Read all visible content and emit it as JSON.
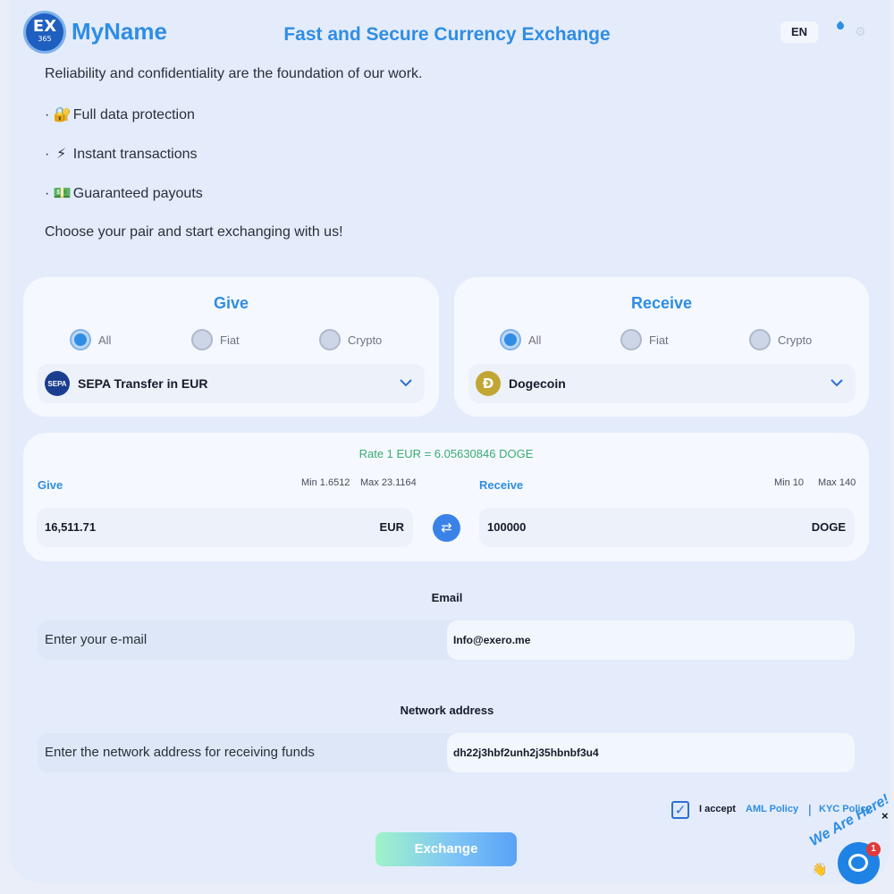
{
  "header": {
    "logo_text": "EX",
    "logo_sub": "365",
    "brand": "MyName",
    "headline": "Fast and Secure Currency Exchange",
    "lang": "EN"
  },
  "intro": {
    "line1": "Reliability and confidentiality are the foundation of our work.",
    "bullet1": "Full data protection",
    "bullet2": "Instant transactions",
    "bullet3": "Guaranteed payouts",
    "cta": "Choose your pair and start exchanging with us!",
    "bullet_prefix": "·",
    "emoji1": "🔐",
    "emoji2": "⚡",
    "emoji3": "💵"
  },
  "give": {
    "title": "Give",
    "filters": [
      "All",
      "Fiat",
      "Crypto"
    ],
    "selected_filter": "All",
    "currency": "SEPA Transfer in EUR",
    "currency_icon": "SEPA"
  },
  "receive": {
    "title": "Receive",
    "filters": [
      "All",
      "Fiat",
      "Crypto"
    ],
    "selected_filter": "All",
    "currency": "Dogecoin",
    "currency_icon": "Ð"
  },
  "calc": {
    "rate": "Rate 1 EUR = 6.05630846 DOGE",
    "give_label": "Give",
    "give_min": "Min 1.6512",
    "give_max": "Max 23.1164",
    "give_amount": "16,511.71",
    "give_currency": "EUR",
    "receive_label": "Receive",
    "receive_min": "Min 10",
    "receive_max": "Max 140",
    "receive_amount": "100000",
    "receive_currency": "DOGE",
    "swap_icon": "⇄"
  },
  "email": {
    "title": "Email",
    "placeholder": "Enter your e-mail",
    "value": "Info@exero.me"
  },
  "network": {
    "title": "Network address",
    "placeholder": "Enter the network address for receiving funds",
    "value": "dh22j3hbf2unh2j35hbnbf3u4"
  },
  "terms": {
    "checked": true,
    "check_mark": "✓",
    "accept": "I accept",
    "aml": "AML Policy",
    "separator": "|",
    "kyc": "KYC Policy"
  },
  "exchange_label": "Exchange",
  "chat": {
    "text": "We Are Here!",
    "badge": "1",
    "close": "×",
    "wave": "👋"
  },
  "colors": {
    "accent": "#2f8de4",
    "rate_green": "#3bab74",
    "background": "#e4ecfb",
    "card": "#f5f8fe"
  }
}
